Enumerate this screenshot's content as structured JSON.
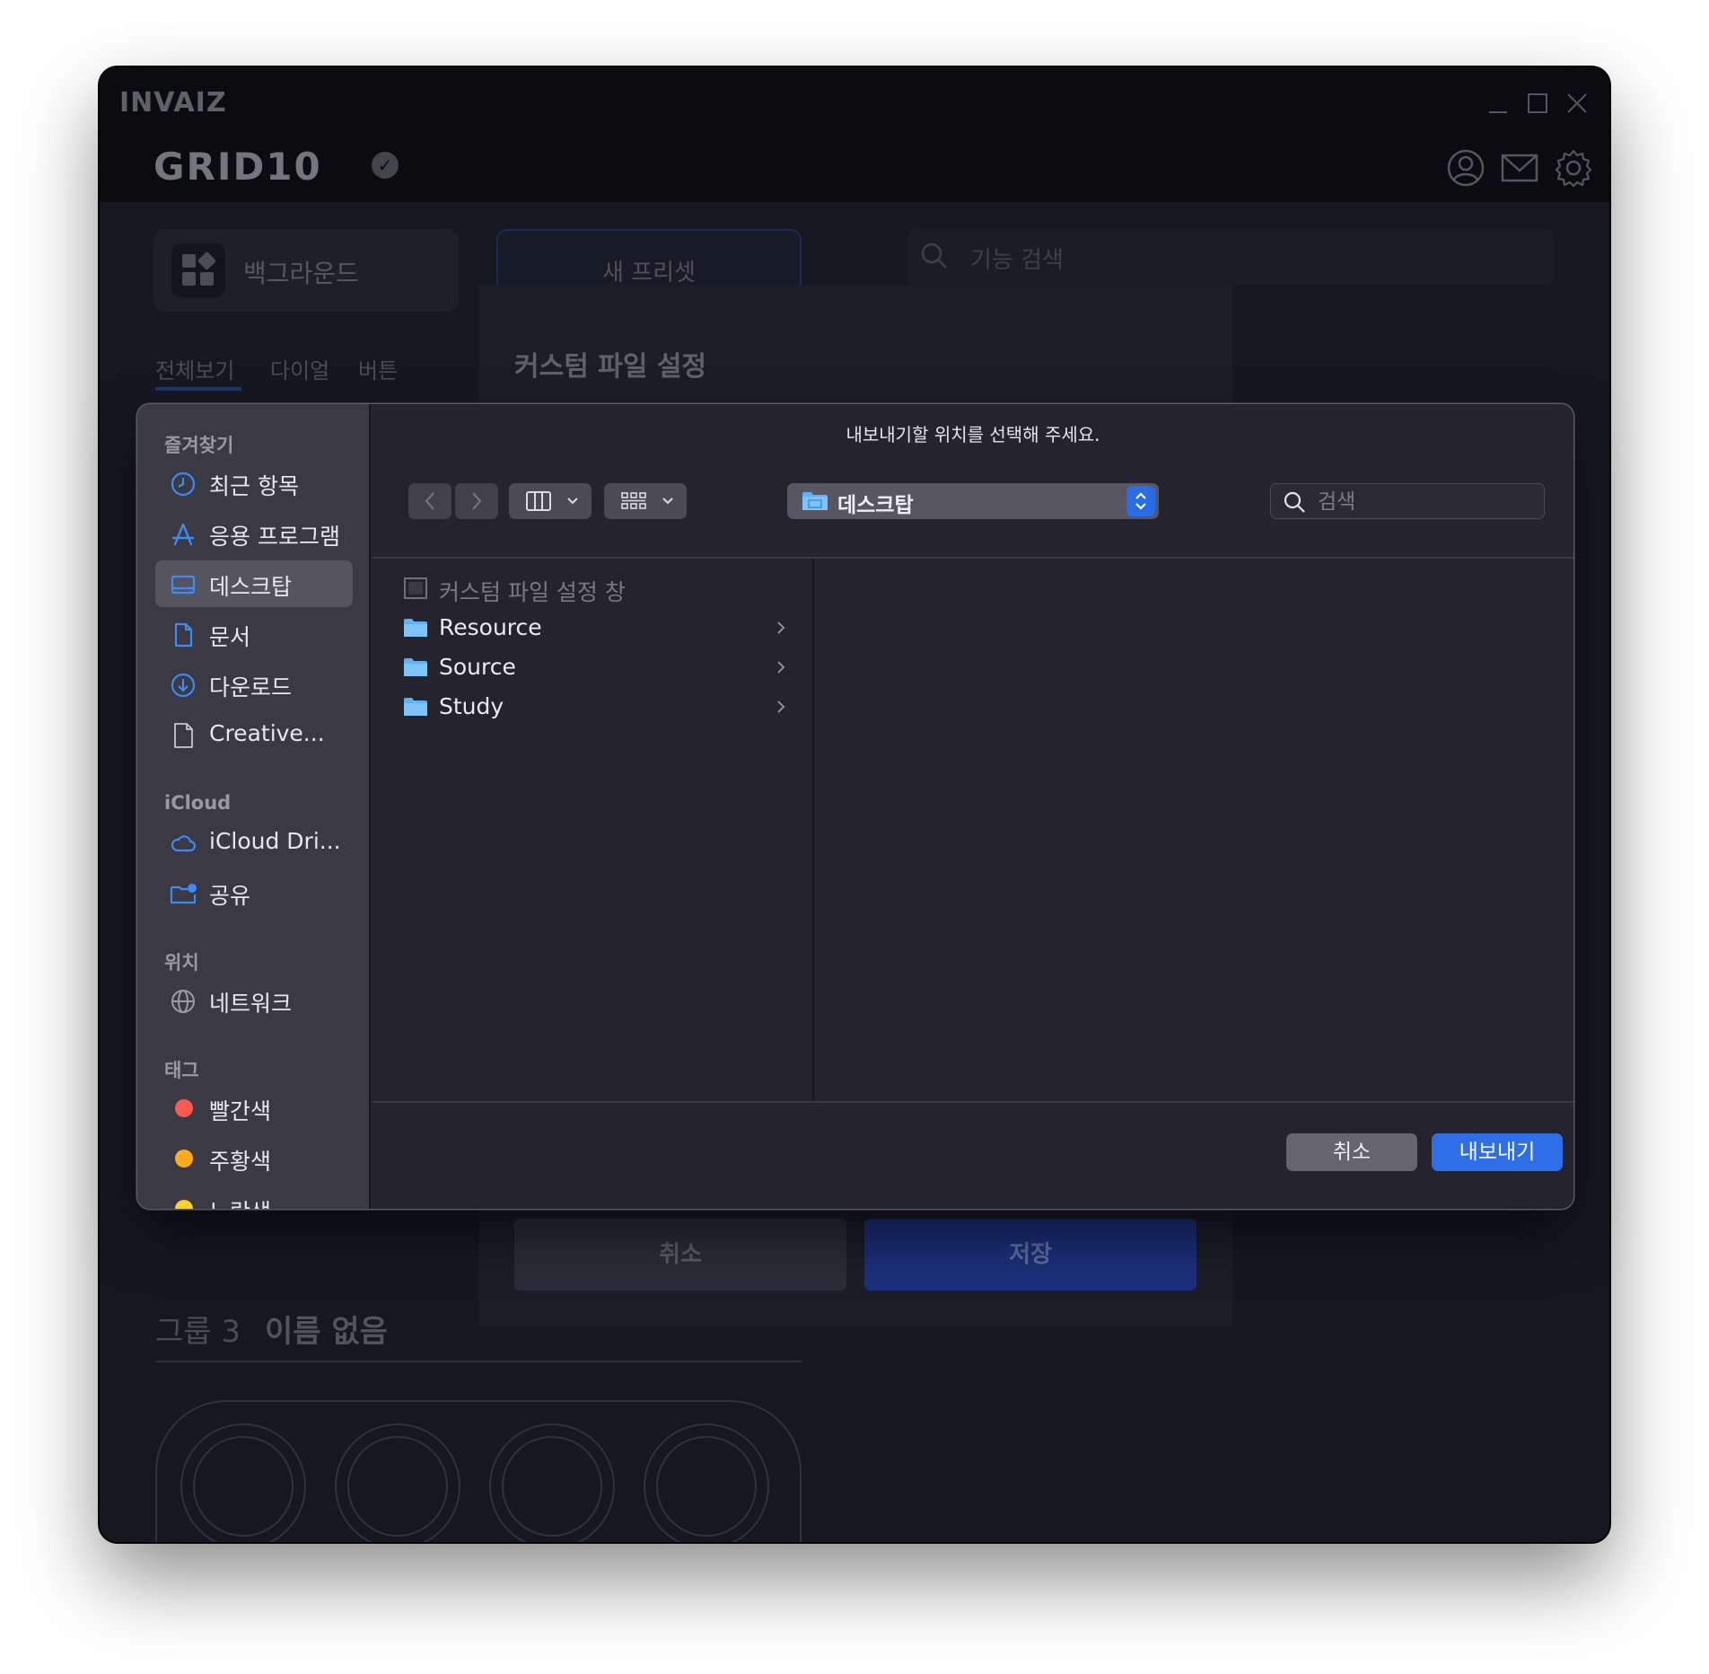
{
  "app": {
    "brand": "INVAIZ",
    "product": "GRID10",
    "window_controls": [
      "minimize-icon",
      "maximize-icon",
      "close-icon"
    ],
    "header_icons": [
      "profile-icon",
      "mail-icon",
      "settings-icon"
    ]
  },
  "background_ui": {
    "background_card_label": "백그라운드",
    "tabs": [
      "전체보기",
      "다이얼",
      "버튼"
    ],
    "preset_tab_label": "새 프리셋",
    "feature_search_placeholder": "기능 검색",
    "custom_panel": {
      "title": "커스텀 파일 설정",
      "cancel_label": "취소",
      "save_label": "저장"
    },
    "group": {
      "title": "그룹 3",
      "name": "이름 없음"
    }
  },
  "dialog": {
    "title": "내보내기할 위치를 선택해 주세요.",
    "sidebar": {
      "favorites_header": "즐겨찾기",
      "favorites": [
        {
          "label": "최근 항목",
          "icon": "clock-icon"
        },
        {
          "label": "응용 프로그램",
          "icon": "app-store-icon"
        },
        {
          "label": "데스크탑",
          "icon": "desktop-icon"
        },
        {
          "label": "문서",
          "icon": "document-icon"
        },
        {
          "label": "다운로드",
          "icon": "download-icon"
        },
        {
          "label": "Creative...",
          "icon": "file-icon"
        }
      ],
      "icloud_header": "iCloud",
      "icloud": [
        {
          "label": "iCloud Dri...",
          "icon": "cloud-icon"
        },
        {
          "label": "공유",
          "icon": "shared-folder-icon"
        }
      ],
      "locations_header": "위치",
      "locations": [
        {
          "label": "네트워크",
          "icon": "network-icon"
        }
      ],
      "tags_header": "태그",
      "tags": [
        {
          "label": "빨간색",
          "color": "#ff5a52"
        },
        {
          "label": "주황색",
          "color": "#ffaa1f"
        },
        {
          "label": "노란색",
          "color": "#f7d22a"
        }
      ]
    },
    "toolbar": {
      "location": "데스크탑",
      "search_placeholder": "검색"
    },
    "files": [
      {
        "name": "커스텀 파일 설정 창",
        "type": "document",
        "disabled": true
      },
      {
        "name": "Resource",
        "type": "folder"
      },
      {
        "name": "Source",
        "type": "folder"
      },
      {
        "name": "Study",
        "type": "folder"
      }
    ],
    "cancel_label": "취소",
    "export_label": "내보내기"
  }
}
